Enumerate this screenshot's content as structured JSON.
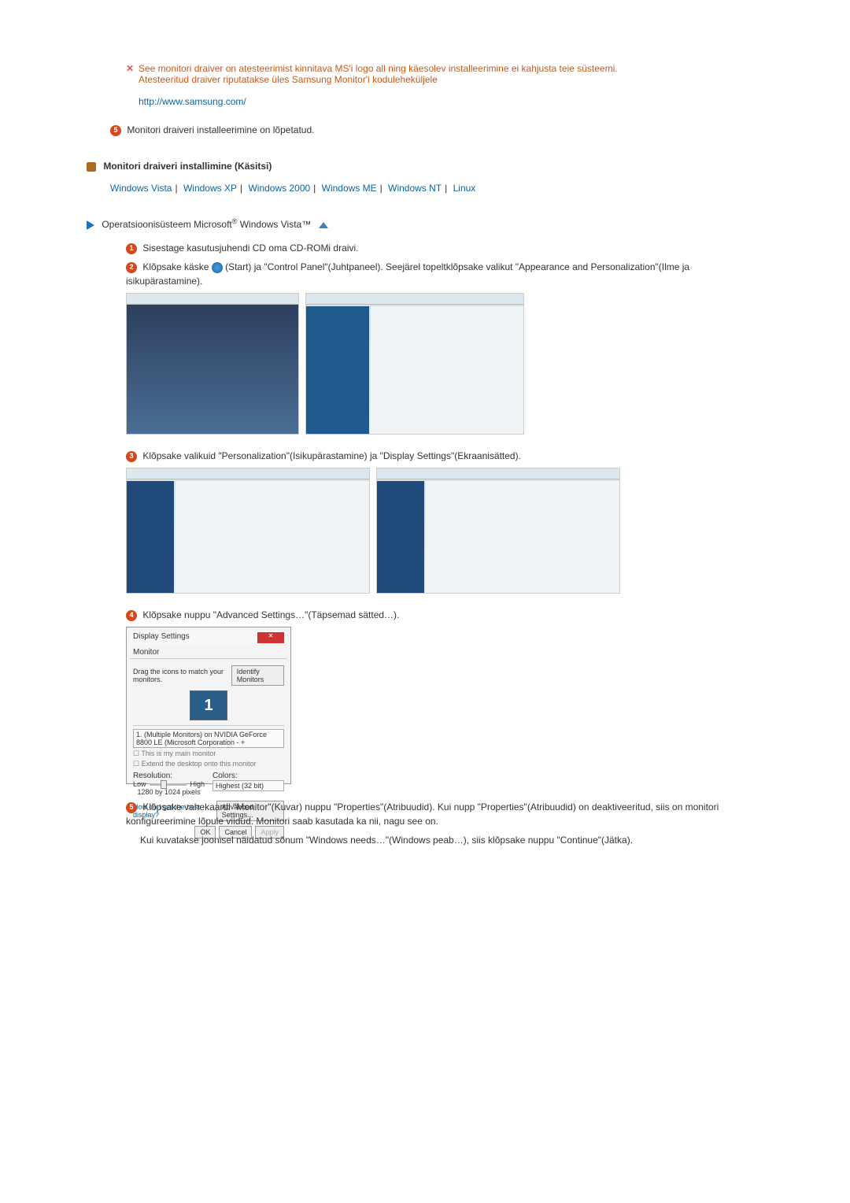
{
  "note": {
    "line1": "See monitori draiver on atesteerimist kinnitava MS'i logo all ning käesolev installeerimine ei kahjusta teie süsteemi.",
    "line2": "Atesteeritud draiver riputatakse üles Samsung Monitor'i koduleheküljele",
    "link": "http://www.samsung.com/"
  },
  "step5": "Monitori draiveri installeerimine on lõpetatud.",
  "heading_manual": "Monitori draiveri installimine (Käsitsi)",
  "os_links": {
    "vista": "Windows Vista",
    "xp": "Windows XP",
    "w2k": "Windows 2000",
    "me": "Windows ME",
    "nt": "Windows NT",
    "linux": "Linux"
  },
  "os_line_prefix": "Operatsioonisüsteem Microsoft",
  "os_line_suffix": " Windows Vista™",
  "vista_steps": {
    "s1": "Sisestage kasutusjuhendi CD oma CD-ROMi draivi.",
    "s2a": "Klõpsake käske ",
    "s2b": "(Start) ja \"Control Panel\"(Juhtpaneel). Seejärel topeltklõpsake valikut \"Appearance and Personalization\"(Ilme ja isikupärastamine).",
    "s3": "Klõpsake valikuid \"Personalization\"(Isikupärastamine) ja \"Display Settings\"(Ekraanisätted).",
    "s4": "Klõpsake nuppu \"Advanced Settings…\"(Täpsemad sätted…).",
    "s5": "Klõpsake vahekaardi \"Monitor\"(Kuvar) nuppu \"Properties\"(Atribuudid). Kui nupp \"Properties\"(Atribuudid) on deaktiveeritud, siis on monitori konfigureerimine lõpule viidud. Monitori saab kasutada ka nii, nagu see on.",
    "s5b": "Kui kuvatakse joonisel näidatud sõnum \"Windows needs…\"(Windows peab…), siis klõpsake nuppu \"Continue\"(Jätka)."
  },
  "display_dialog": {
    "title": "Display Settings",
    "tab": "Monitor",
    "drag_text": "Drag the icons to match your monitors.",
    "identify": "Identify Monitors",
    "monitor_num": "1",
    "select_text": "1. (Multiple Monitors) on NVIDIA GeForce 8800 LE (Microsoft Corporation - +",
    "cb1": "This is my main monitor",
    "cb2": "Extend the desktop onto this monitor",
    "res_label": "Resolution:",
    "low": "Low",
    "high": "High",
    "res_text": "1280 by 1024 pixels",
    "colors_label": "Colors:",
    "colors_val": "Highest (32 bit)",
    "help_link": "How do I get the best display?",
    "adv": "Advanced Settings...",
    "ok": "OK",
    "cancel": "Cancel",
    "apply": "Apply"
  }
}
